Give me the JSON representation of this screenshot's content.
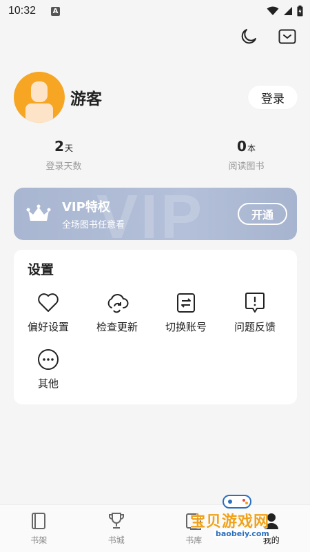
{
  "status_bar": {
    "time": "10:32",
    "notification_badge": "A"
  },
  "profile": {
    "username": "游客",
    "login_label": "登录"
  },
  "stats": [
    {
      "value": "2",
      "unit": "天",
      "label": "登录天数"
    },
    {
      "value": "0",
      "unit": "本",
      "label": "阅读图书"
    }
  ],
  "vip": {
    "title": "VIP特权",
    "subtitle": "全场图书任意看",
    "button_label": "开通",
    "watermark": "VIP"
  },
  "settings": {
    "title": "设置",
    "items": [
      {
        "label": "偏好设置",
        "icon": "heart-icon"
      },
      {
        "label": "检查更新",
        "icon": "cloud-refresh-icon"
      },
      {
        "label": "切换账号",
        "icon": "switch-account-icon"
      },
      {
        "label": "问题反馈",
        "icon": "feedback-icon"
      },
      {
        "label": "其他",
        "icon": "more-icon"
      }
    ]
  },
  "bottom_nav": [
    {
      "label": "书架",
      "icon": "bookshelf-icon"
    },
    {
      "label": "书城",
      "icon": "trophy-icon"
    },
    {
      "label": "书库",
      "icon": "library-icon"
    },
    {
      "label": "我的",
      "icon": "profile-icon"
    }
  ],
  "watermark": {
    "text": "宝贝游戏网",
    "url": "baobeiy.com"
  },
  "colors": {
    "background": "#f5f5f5",
    "avatar": "#f6a623",
    "vip_card": "#aebbd4",
    "card": "#ffffff",
    "accent_watermark": "#f0a21a"
  }
}
